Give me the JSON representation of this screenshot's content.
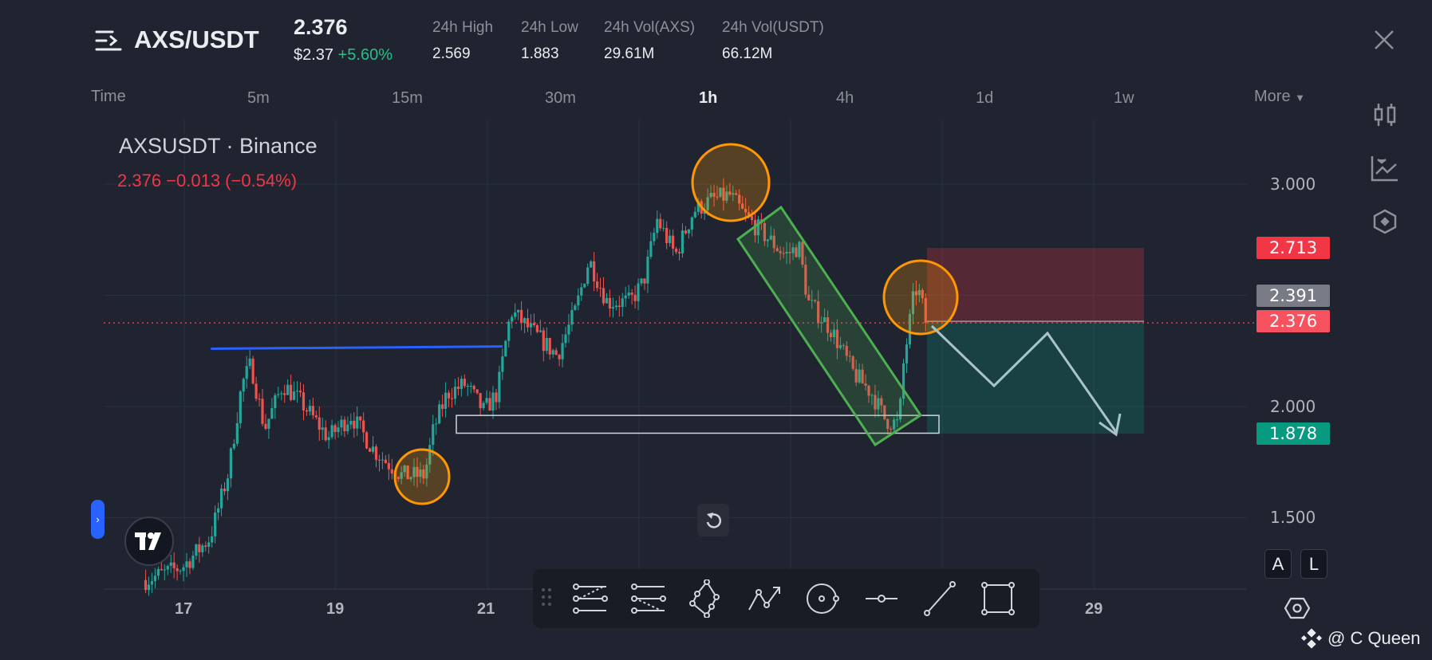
{
  "header": {
    "pair": "AXS/USDT",
    "last_price": "2.376",
    "usd_price": "$2.37",
    "change_pct": "+5.60%",
    "stats": [
      {
        "label": "24h High",
        "value": "2.569"
      },
      {
        "label": "24h Low",
        "value": "1.883"
      },
      {
        "label": "24h Vol(AXS)",
        "value": "29.61M"
      },
      {
        "label": "24h Vol(USDT)",
        "value": "66.12M"
      }
    ]
  },
  "timeframes": [
    "Time",
    "5m",
    "15m",
    "30m",
    "1h",
    "4h",
    "1d",
    "1w"
  ],
  "active_timeframe": "1h",
  "more_label": "More",
  "legend": {
    "symbol": "AXSUSDT · Binance",
    "ohlc": "2.376  −0.013 (−0.54%)"
  },
  "price_axis": [
    "3.000",
    "2.000",
    "1.500"
  ],
  "price_labels": {
    "stop": "2.713",
    "high": "2.391",
    "last": "2.376",
    "target": "1.878"
  },
  "date_axis": [
    "17",
    "19",
    "21",
    "29"
  ],
  "buttons": {
    "auto": "A",
    "log": "L"
  },
  "watermark": "@ C Queen",
  "colors": {
    "up": "#26a69a",
    "down": "#ef5350",
    "accent_orange": "#ff9800",
    "channel": "#4caf50",
    "support_line": "#2962ff"
  },
  "chart_data": {
    "type": "candlestick",
    "timeframe": "1h",
    "ylim": [
      1.2,
      3.1
    ],
    "xlim_days": [
      16,
      30
    ],
    "keypoints_day_price": [
      [
        16.49,
        1.22
      ],
      [
        16.98,
        1.28
      ],
      [
        17.34,
        1.41
      ],
      [
        17.58,
        1.7
      ],
      [
        17.76,
        2.1
      ],
      [
        17.88,
        2.19
      ],
      [
        18.06,
        1.9
      ],
      [
        18.3,
        2.1
      ],
      [
        18.54,
        2.02
      ],
      [
        18.9,
        1.86
      ],
      [
        19.2,
        1.96
      ],
      [
        19.51,
        1.8
      ],
      [
        19.87,
        1.69
      ],
      [
        20.17,
        1.69
      ],
      [
        20.29,
        1.9
      ],
      [
        20.47,
        2.06
      ],
      [
        20.71,
        2.1
      ],
      [
        20.95,
        1.98
      ],
      [
        21.13,
        2.06
      ],
      [
        21.31,
        2.43
      ],
      [
        21.55,
        2.35
      ],
      [
        21.92,
        2.23
      ],
      [
        22.16,
        2.43
      ],
      [
        22.34,
        2.66
      ],
      [
        22.58,
        2.47
      ],
      [
        22.88,
        2.47
      ],
      [
        23.06,
        2.56
      ],
      [
        23.24,
        2.84
      ],
      [
        23.48,
        2.68
      ],
      [
        23.72,
        2.88
      ],
      [
        23.96,
        2.93
      ],
      [
        24.2,
        2.95
      ],
      [
        24.39,
        2.86
      ],
      [
        24.69,
        2.76
      ],
      [
        24.93,
        2.68
      ],
      [
        25.11,
        2.72
      ],
      [
        25.23,
        2.47
      ],
      [
        25.53,
        2.35
      ],
      [
        25.83,
        2.15
      ],
      [
        26.07,
        2.06
      ],
      [
        26.25,
        1.94
      ],
      [
        26.43,
        1.92
      ],
      [
        26.49,
        2.19
      ],
      [
        26.61,
        2.47
      ],
      [
        26.67,
        2.54
      ],
      [
        26.8,
        2.376
      ]
    ],
    "annotations": {
      "resistance_line": [
        [
          17.35,
          2.26
        ],
        [
          21.2,
          2.27
        ]
      ],
      "support_zone": [
        1.88,
        1.96
      ],
      "position": {
        "entry": 2.376,
        "stop": 2.713,
        "target": 1.878
      }
    }
  }
}
